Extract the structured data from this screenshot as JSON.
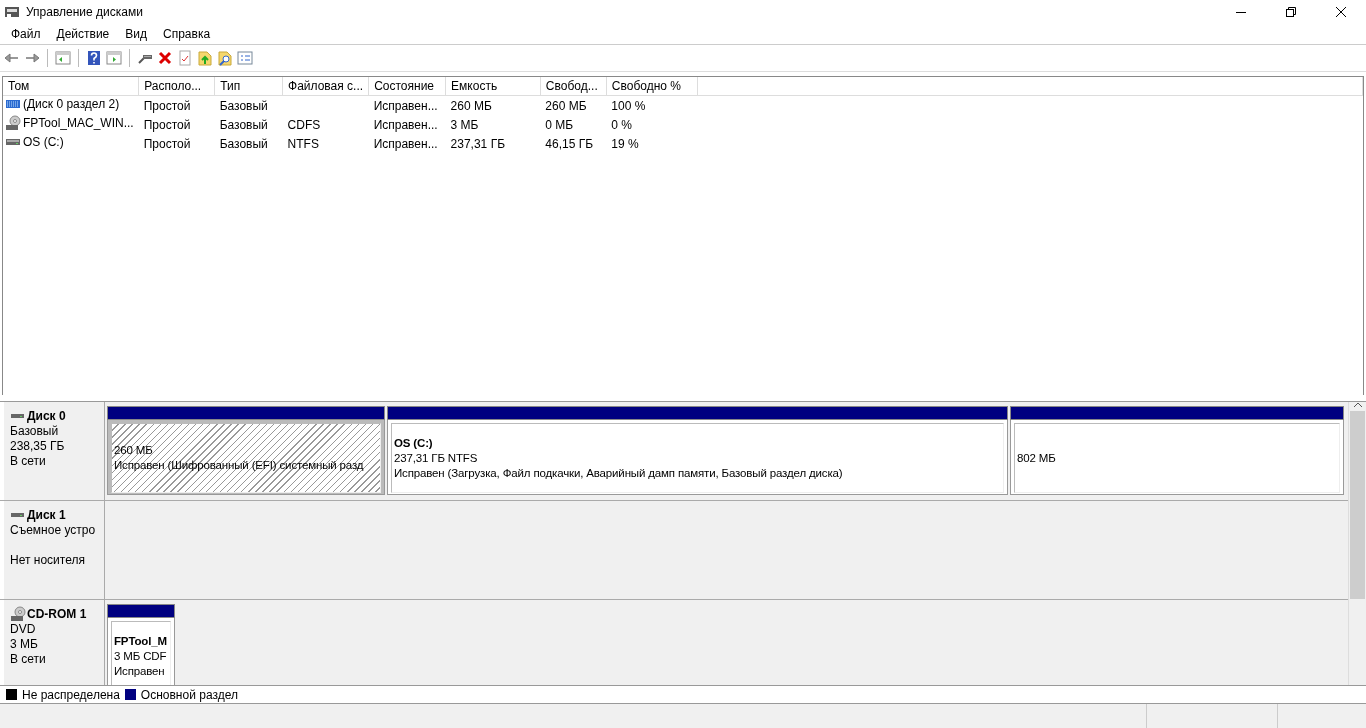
{
  "window": {
    "title": "Управление дисками"
  },
  "menu": [
    {
      "label": "Файл"
    },
    {
      "label": "Действие"
    },
    {
      "label": "Вид"
    },
    {
      "label": "Справка"
    }
  ],
  "volumes": {
    "columns": [
      "Том",
      "Располо...",
      "Тип",
      "Файловая с...",
      "Состояние",
      "Емкость",
      "Свобод...",
      "Свободно %"
    ],
    "rows": [
      {
        "kind": "partition",
        "cells": [
          "(Диск 0 раздел 2)",
          "Простой",
          "Базовый",
          "",
          "Исправен...",
          "260 МБ",
          "260 МБ",
          "100 %"
        ]
      },
      {
        "kind": "cd",
        "cells": [
          "FPTool_MAC_WIN...",
          "Простой",
          "Базовый",
          "CDFS",
          "Исправен...",
          "3 МБ",
          "0 МБ",
          "0 %"
        ]
      },
      {
        "kind": "drive",
        "cells": [
          "OS (C:)",
          "Простой",
          "Базовый",
          "NTFS",
          "Исправен...",
          "237,31 ГБ",
          "46,15 ГБ",
          "19 %"
        ]
      }
    ]
  },
  "disks": [
    {
      "kind": "disk",
      "name": "Диск 0",
      "type": "Базовый",
      "size": "238,35 ГБ",
      "status": "В сети",
      "partitions": [
        {
          "kind": "hatched",
          "lines": [
            "260 МБ",
            "Исправен (Шифрованный (EFI) системный разд"
          ]
        },
        {
          "kind": "plain",
          "name": "OS  (C:)",
          "lines": [
            "237,31 ГБ NTFS",
            "Исправен (Загрузка, Файл подкачки, Аварийный дамп памяти, Базовый раздел диска)"
          ]
        },
        {
          "kind": "plain",
          "lines": [
            "802 МБ"
          ]
        }
      ]
    },
    {
      "kind": "disk",
      "name": "Диск 1",
      "type": "Съемное устро",
      "status": "Нет носителя"
    },
    {
      "kind": "cd",
      "name": "CD-ROM 1",
      "type": "DVD",
      "size": "3 МБ",
      "status": "В сети",
      "partitions": [
        {
          "kind": "plain",
          "name": "FPTool_M",
          "lines": [
            "3 МБ CDF",
            "Исправен"
          ]
        }
      ]
    }
  ],
  "legend": [
    {
      "label": "Не распределена",
      "color": "#000000"
    },
    {
      "label": "Основной раздел",
      "color": "#000080"
    }
  ]
}
